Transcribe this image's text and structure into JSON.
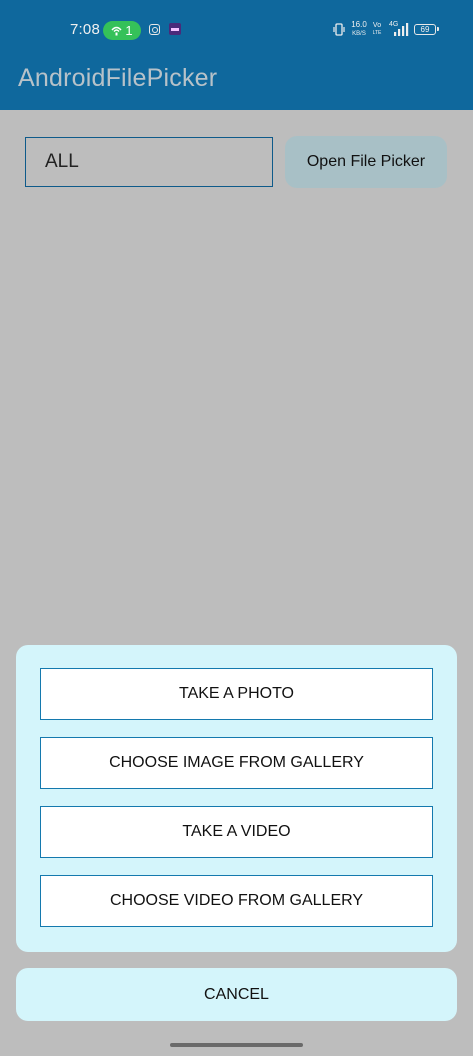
{
  "status_bar": {
    "time": "7:08",
    "hotspot_count": "1",
    "net_speed_value": "16.0",
    "net_speed_unit": "KB/S",
    "volte_top": "Vo",
    "volte_bottom": "LTE",
    "network_type": "4G",
    "battery_level": "69"
  },
  "app_bar": {
    "title": "AndroidFilePicker"
  },
  "main": {
    "type_input_value": "ALL",
    "open_picker_label": "Open File Picker"
  },
  "dialog": {
    "options": [
      {
        "label": "TAKE A PHOTO"
      },
      {
        "label": "CHOOSE IMAGE FROM GALLERY"
      },
      {
        "label": "TAKE A VIDEO"
      },
      {
        "label": "CHOOSE VIDEO FROM GALLERY"
      }
    ],
    "cancel_label": "CANCEL"
  },
  "colors": {
    "app_bar_dimmed": "#0f689d",
    "scrim_background": "#bdbdbd",
    "dialog_background": "#d4f5fb",
    "option_border": "#1479ae",
    "picker_button_dimmed": "#a8c0c6",
    "hotspot_pill": "#35c159"
  },
  "icons": [
    "hotspot-icon",
    "instagram-icon",
    "app-notification-icon",
    "vibrate-icon",
    "signal-icon",
    "battery-icon"
  ]
}
